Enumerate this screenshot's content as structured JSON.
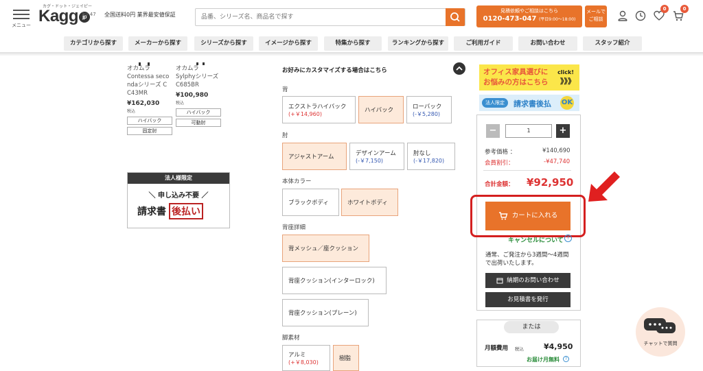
{
  "header": {
    "menu_label": "メニュー",
    "logo_text": "Kagg",
    "logo_jp": "jp",
    "logo_sub": "カグ・ドット・ジェイピー",
    "logo_by": "by 47",
    "promo": "全国送料0円 業界最安値保証",
    "search_placeholder": "品番、シリーズ名、商品名で探す",
    "tel_line1": "見積依頼やご相談はこちら",
    "tel_number": "0120-473-047",
    "tel_hours": "(平日9:00〜18:00)",
    "mail_line1": "メールで",
    "mail_line2": "ご相談",
    "favorite_count": "0",
    "cart_count": "0",
    "colors": {
      "accent": "#e8732a"
    }
  },
  "nav": [
    "カテゴリから探す",
    "メーカーから探す",
    "シリーズから探す",
    "イメージから探す",
    "特集から探す",
    "ランキングから探す",
    "ご利用ガイド",
    "お問い合わせ",
    "スタッフ紹介"
  ],
  "products": [
    {
      "maker": "オカムラ",
      "name_lines": [
        "Contessa seco",
        "ndaシリーズ C",
        "C43MR"
      ],
      "price": "¥162,030",
      "tax": "税込",
      "tags": [
        "ハイバック",
        "固定肘"
      ]
    },
    {
      "maker": "オカムラ",
      "name_lines": [
        "Sylphyシリーズ",
        "C685BR"
      ],
      "price": "¥100,980",
      "tax": "税込",
      "tags": [
        "ハイバック",
        "可動肘"
      ]
    }
  ],
  "corp_banner": {
    "top": "法人様限定",
    "mid": "＼ 申し込み不要 ／",
    "low1": "請求書",
    "low2": "後払い"
  },
  "customize": {
    "title": "お好みにカスタマイズする場合はこちら",
    "sections": [
      {
        "label": "背",
        "options": [
          {
            "name": "エクストラハイバック",
            "diff": "(+￥14,960)",
            "dir": "plus",
            "selected": false
          },
          {
            "name": "ハイバック",
            "diff": "",
            "dir": "",
            "selected": true
          },
          {
            "name": "ローバック",
            "diff": "(-￥5,280)",
            "dir": "minus",
            "selected": false
          }
        ]
      },
      {
        "label": "肘",
        "options": [
          {
            "name": "アジャストアーム",
            "diff": "",
            "dir": "",
            "selected": true
          },
          {
            "name": "デザインアーム",
            "diff": "(-￥7,150)",
            "dir": "minus",
            "selected": false
          },
          {
            "name": "肘なし",
            "diff": "(-￥17,820)",
            "dir": "minus",
            "selected": false
          }
        ]
      },
      {
        "label": "本体カラー",
        "options": [
          {
            "name": "ブラックボディ",
            "diff": "",
            "dir": "",
            "selected": false
          },
          {
            "name": "ホワイトボディ",
            "diff": "",
            "dir": "",
            "selected": true
          }
        ]
      },
      {
        "label": "背座詳細",
        "options": [
          {
            "name": "背メッシュ／座クッション",
            "diff": "",
            "dir": "",
            "selected": true
          },
          {
            "name": "背座クッション(インターロック)",
            "diff": "",
            "dir": "",
            "selected": false
          },
          {
            "name": "背座クッション(プレーン)",
            "diff": "",
            "dir": "",
            "selected": false
          }
        ]
      },
      {
        "label": "脚素材",
        "options": [
          {
            "name": "アルミ",
            "diff": "(+￥8,030)",
            "dir": "plus",
            "selected": false
          },
          {
            "name": "樹脂",
            "diff": "",
            "dir": "",
            "selected": true
          }
        ]
      }
    ]
  },
  "sidebar": {
    "office_text1": "オフィス家具選びに",
    "office_text2": "お悩みの方はこちら",
    "office_click": "click!",
    "office_arrows": "》》》",
    "invoice_pill": "法人限定",
    "invoice_text": "請求書後払",
    "invoice_ok": "OK",
    "qty_value": "1",
    "ref_label": "参考価格 ：",
    "ref_value": "¥140,690",
    "discount_label": "会員割引：",
    "discount_value": "-¥47,740",
    "total_label": "合計金額：",
    "total_value": "¥92,950",
    "cart_label": "カートに入れる",
    "cancel_text": "キャンセルについて",
    "ship_text": "通常、ご発注から3週間〜4週間で出荷いたします。",
    "delivery_btn": "納期のお問い合わせ",
    "quote_btn": "お見積書を発行",
    "or_label": "または",
    "monthly_label": "月額費用",
    "monthly_tax": "税込",
    "monthly_value": "¥4,950",
    "monthly_note": "お届け月無料"
  },
  "chat": {
    "label": "チャットで質問"
  }
}
